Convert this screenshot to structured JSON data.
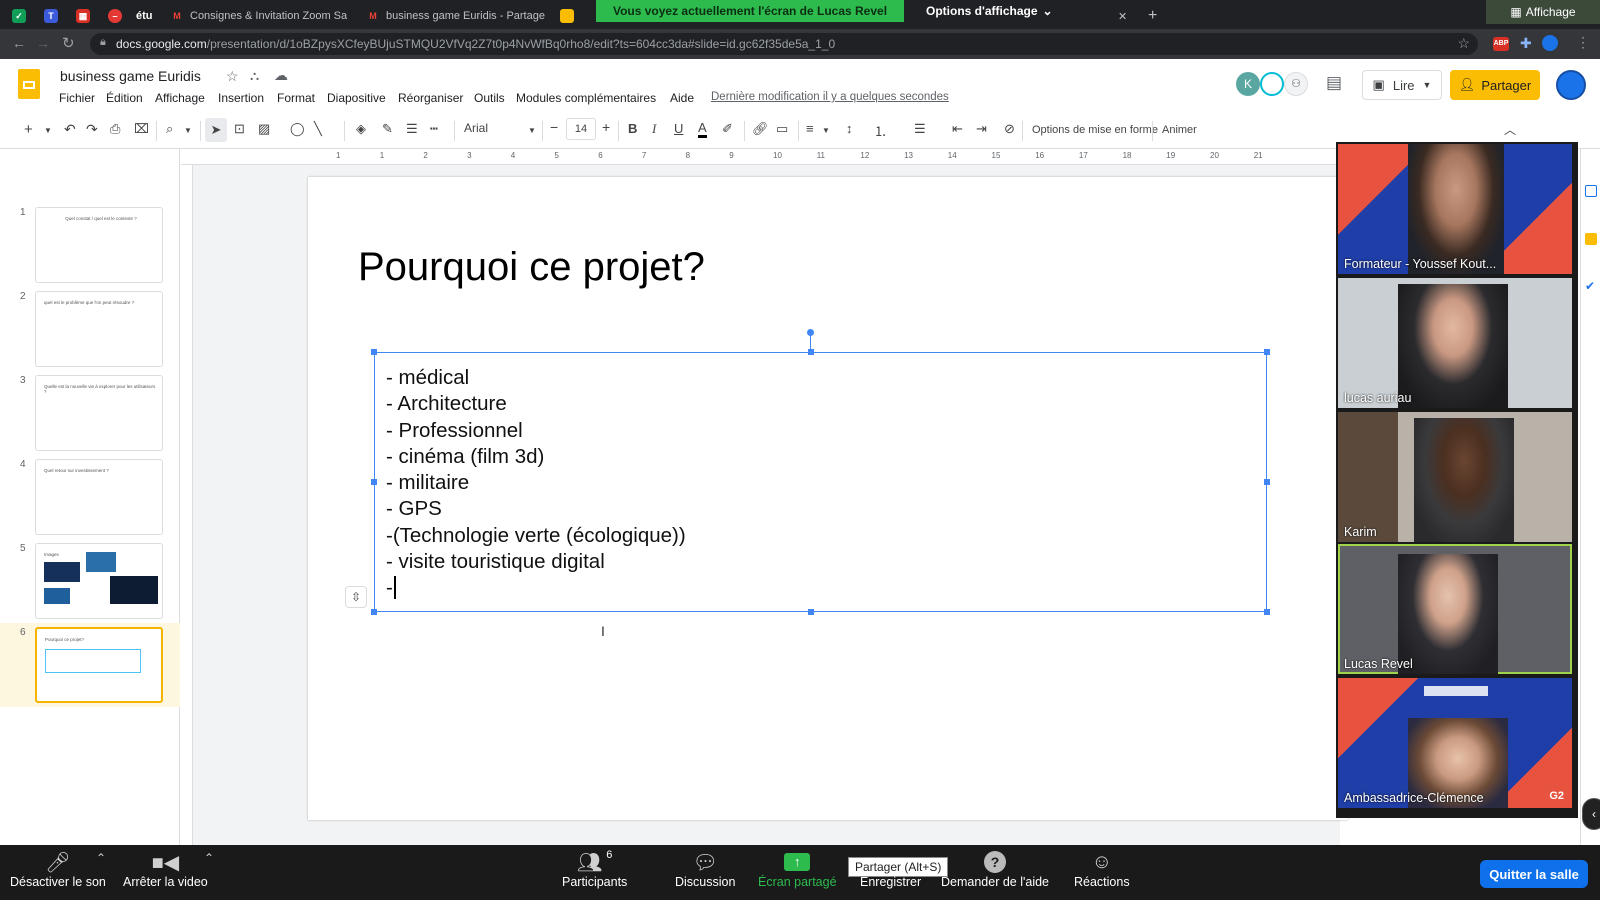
{
  "browser": {
    "tabs": [
      {
        "label": "étu"
      },
      {
        "label": "Consignes & Invitation Zoom Sa"
      },
      {
        "label": "business game Euridis - Partage"
      }
    ],
    "share_banner": "Vous voyez actuellement l'écran de Lucas Revel",
    "view_options": "Options d'affichage",
    "affichage": "Affichage",
    "url_domain": "docs.google.com",
    "url_path": "/presentation/d/1oBZpysXCfeyBUjuSTMQU2VfVq2Z7t0p4NvWfBq0rho8/edit?ts=604cc3da#slide=id.gc62f35de5a_1_0"
  },
  "docs": {
    "title": "business game Euridis",
    "menu": [
      "Fichier",
      "Édition",
      "Affichage",
      "Insertion",
      "Format",
      "Diapositive",
      "Réorganiser",
      "Outils",
      "Modules complémentaires",
      "Aide"
    ],
    "last_edit": "Dernière modification il y a quelques secondes",
    "lire": "Lire",
    "partager": "Partager",
    "avatar_letter": "K",
    "toolbar": {
      "font": "Arial",
      "font_size": "14",
      "format_options": "Options de mise en forme",
      "animate": "Animer"
    },
    "ruler_marks": [
      "1",
      "1",
      "2",
      "3",
      "4",
      "5",
      "6",
      "7",
      "8",
      "9",
      "10",
      "11",
      "12",
      "13",
      "14",
      "15",
      "16",
      "17",
      "18",
      "19",
      "20",
      "21"
    ],
    "thumbnails": [
      {
        "num": "1",
        "text": "Quel constat / quel est le contexte ?"
      },
      {
        "num": "2",
        "text": "quel est le problème que l'on peut résoudre ?"
      },
      {
        "num": "3",
        "text": "Quelle est la nouvelle vie à explorer pour les utilisateurs ?"
      },
      {
        "num": "4",
        "text": "Quel retour sur investissement ?"
      },
      {
        "num": "5",
        "text": "Images"
      },
      {
        "num": "6",
        "text": "Pourquoi ce projet?"
      }
    ],
    "slide": {
      "title": "Pourquoi ce projet?",
      "bullets": [
        "- médical",
        "- Architecture",
        "- Professionnel",
        "- cinéma (film 3d)",
        "- militaire",
        "- GPS",
        "-(Technologie verte (écologique))",
        "- visite touristique digital",
        "-"
      ]
    }
  },
  "participants_video": [
    {
      "name": "Formateur - Youssef Kout..."
    },
    {
      "name": "lucas auriau"
    },
    {
      "name": "Karim"
    },
    {
      "name": "Lucas Revel"
    },
    {
      "name": "Ambassadrice-Clémence"
    }
  ],
  "zoom_toolbar": {
    "mute": "Désactiver le son",
    "video": "Arrêter la video",
    "participants": "Participants",
    "participants_count": "6",
    "chat": "Discussion",
    "share": "Écran partagé",
    "share_tooltip": "Partager (Alt+S)",
    "record": "Enregistrer",
    "help": "Demander de l'aide",
    "reactions": "Réactions",
    "quit": "Quitter la salle"
  },
  "colors": {
    "share_banner": "#2dbb4e",
    "partager_button": "#fbbc04",
    "selection": "#4285f4",
    "quit_button": "#0e71eb",
    "active_speaker_border": "#9ed34b"
  }
}
